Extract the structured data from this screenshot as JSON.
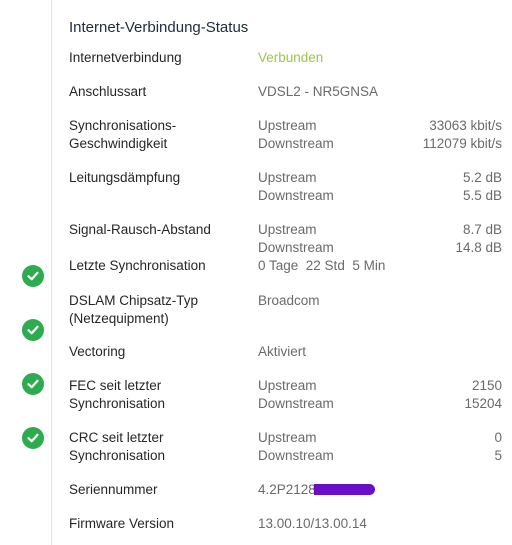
{
  "panel": {
    "title": "Internet-Verbindung-Status"
  },
  "rows": {
    "internet": {
      "label": "Internetverbindung",
      "value": "Verbunden"
    },
    "type": {
      "label": "Anschlussart",
      "value": "VDSL2 - NR5GNSA"
    },
    "sync_speed": {
      "label1": "Synchronisations-",
      "label2": "Geschwindigkeit",
      "up_label": "Upstream",
      "down_label": "Downstream",
      "up_value": "33063 kbit/s",
      "down_value": "112079 kbit/s"
    },
    "attenuation": {
      "label": "Leitungsdämpfung",
      "up_label": "Upstream",
      "down_label": "Downstream",
      "up_value": "5.2 dB",
      "down_value": "5.5 dB"
    },
    "snr": {
      "label": "Signal-Rausch-Abstand",
      "up_label": "Upstream",
      "down_label": "Downstream",
      "up_value": "8.7 dB",
      "down_value": "14.8 dB"
    },
    "last_sync": {
      "label": "Letzte Synchronisation",
      "value": "0 Tage  22 Std  5 Min"
    },
    "dslam": {
      "label1": "DSLAM Chipsatz-Typ",
      "label2": "(Netzequipment)",
      "value": "Broadcom"
    },
    "vectoring": {
      "label": "Vectoring",
      "value": "Aktiviert"
    },
    "fec": {
      "label1": "FEC seit letzter",
      "label2": "Synchronisation",
      "up_label": "Upstream",
      "down_label": "Downstream",
      "up_value": "2150",
      "down_value": "15204"
    },
    "crc": {
      "label1": "CRC seit letzter",
      "label2": "Synchronisation",
      "up_label": "Upstream",
      "down_label": "Downstream",
      "up_value": "0",
      "down_value": "5"
    },
    "serial": {
      "label": "Seriennummer",
      "value": "4.2P2128"
    },
    "firmware": {
      "label": "Firmware Version",
      "value": "13.00.10/13.00.14"
    }
  },
  "timeline": {
    "icon": "check-circle-icon",
    "color": "#2dab4f"
  },
  "colors": {
    "connected": "#9dc54b",
    "title": "#1e2a44",
    "redaction": "#6a0fc9"
  }
}
